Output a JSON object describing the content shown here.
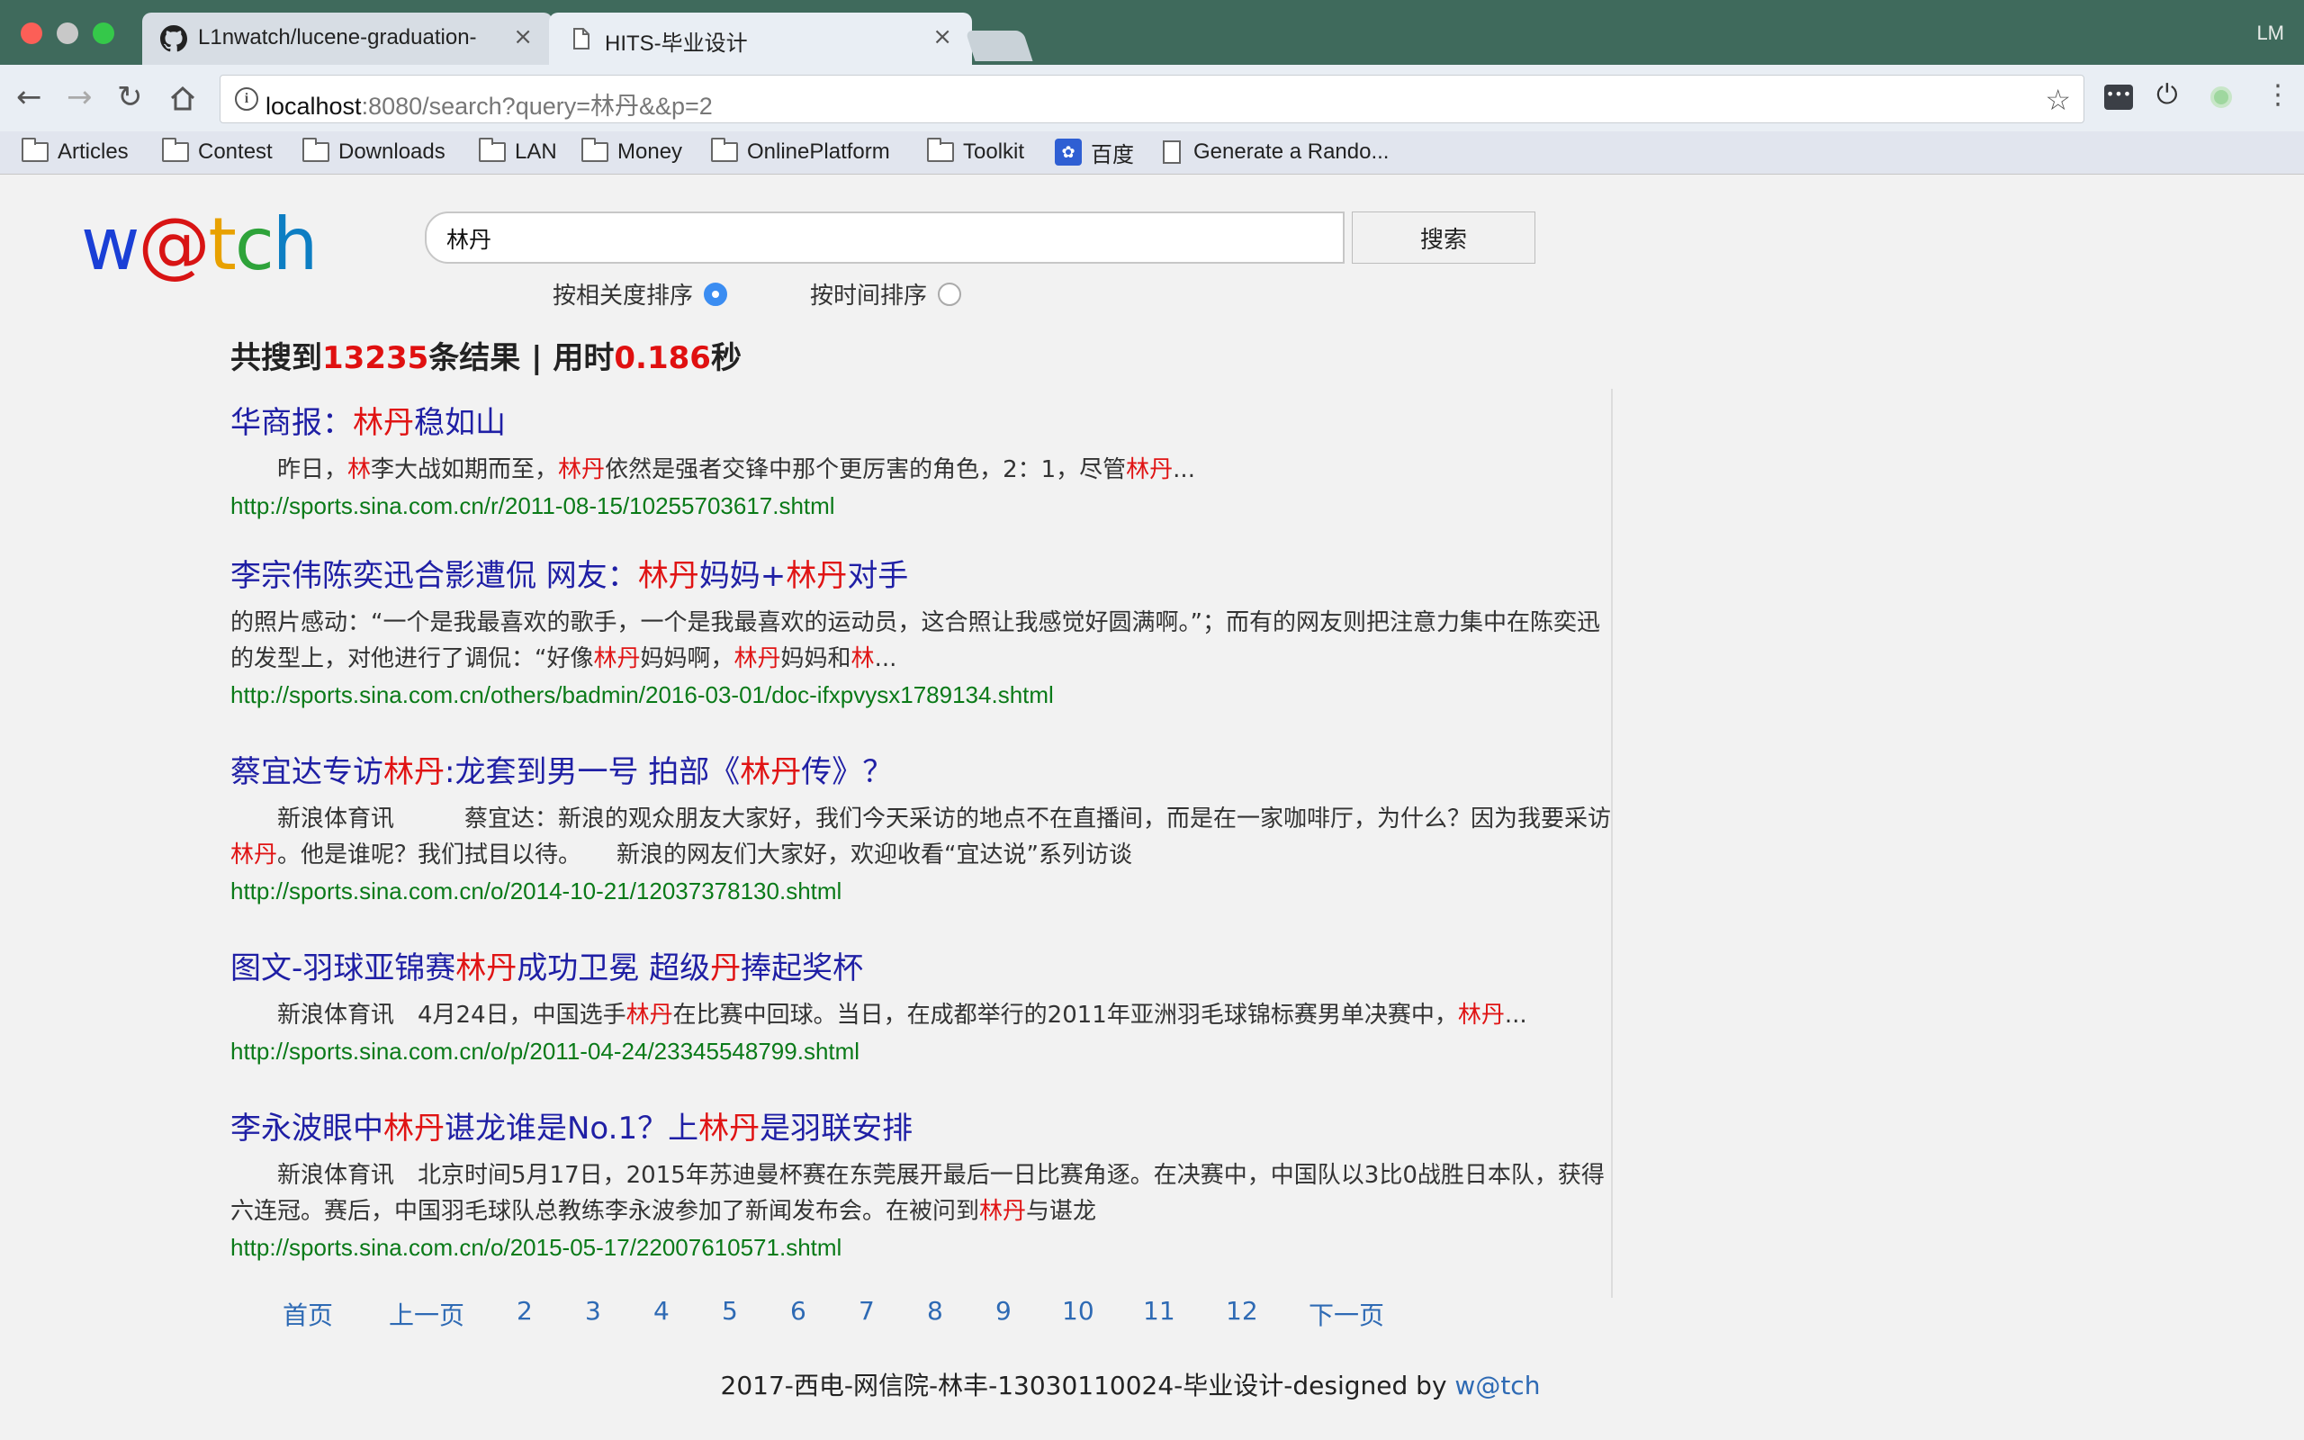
{
  "browser": {
    "profile": "LM",
    "tabs": [
      {
        "title": "L1nwatch/lucene-graduation-",
        "active": false
      },
      {
        "title": "HITS-毕业设计",
        "active": true
      }
    ],
    "url_host": "localhost",
    "url_rest": ":8080/search?query=林丹&&p=2",
    "bookmarks": [
      {
        "label": "Articles",
        "icon": "folder-icon"
      },
      {
        "label": "Contest",
        "icon": "folder-icon"
      },
      {
        "label": "Downloads",
        "icon": "folder-icon"
      },
      {
        "label": "LAN",
        "icon": "folder-icon"
      },
      {
        "label": "Money",
        "icon": "folder-icon"
      },
      {
        "label": "OnlinePlatform",
        "icon": "folder-icon"
      },
      {
        "label": "Toolkit",
        "icon": "folder-icon"
      },
      {
        "label": "百度",
        "icon": "baidu-paw-icon"
      },
      {
        "label": "Generate a Rando...",
        "icon": "page-icon"
      }
    ]
  },
  "logo": {
    "w": "w",
    "at": "@",
    "t": "t",
    "c": "c",
    "h": "h"
  },
  "search": {
    "query": "林丹",
    "button_label": "搜索",
    "sort_relevance": "按相关度排序",
    "sort_time": "按时间排序",
    "selected_sort": "relevance"
  },
  "summary": {
    "prefix": "共搜到",
    "count": "13235",
    "middle": "条结果 | 用时",
    "time": "0.186",
    "suffix": "秒"
  },
  "results": [
    {
      "title": [
        [
          "华商报：",
          false
        ],
        [
          "林丹",
          true
        ],
        [
          "稳如山",
          false
        ]
      ],
      "snippet": [
        [
          "　　昨日，",
          false
        ],
        [
          "林",
          true
        ],
        [
          "李大战如期而至，",
          false
        ],
        [
          "林丹",
          true
        ],
        [
          "依然是强者交锋中那个更厉害的角色，2：1，尽管",
          false
        ],
        [
          "林丹",
          true
        ],
        [
          "...",
          false
        ]
      ],
      "url": "http://sports.sina.com.cn/r/2011-08-15/10255703617.shtml"
    },
    {
      "title": [
        [
          "李宗伟陈奕迅合影遭侃 网友：",
          false
        ],
        [
          "林丹",
          true
        ],
        [
          "妈妈+",
          false
        ],
        [
          "林丹",
          true
        ],
        [
          "对手",
          false
        ]
      ],
      "snippet": [
        [
          "的照片感动：“一个是我最喜欢的歌手，一个是我最喜欢的运动员，这合照让我感觉好圆满啊。”；而有的网友则把注意力集中在陈奕迅的发型上，对他进行了调侃：“好像",
          false
        ],
        [
          "林丹",
          true
        ],
        [
          "妈妈啊，",
          false
        ],
        [
          "林丹",
          true
        ],
        [
          "妈妈和",
          false
        ],
        [
          "林",
          true
        ],
        [
          "...",
          false
        ]
      ],
      "url": "http://sports.sina.com.cn/others/badmin/2016-03-01/doc-ifxpvysx1789134.shtml"
    },
    {
      "title": [
        [
          "蔡宜达专访",
          false
        ],
        [
          "林丹",
          true
        ],
        [
          ":龙套到男一号 拍部《",
          false
        ],
        [
          "林丹",
          true
        ],
        [
          "传》？",
          false
        ]
      ],
      "snippet": [
        [
          "　　新浪体育讯　　　蔡宜达：新浪的观众朋友大家好，我们今天采访的地点不在直播间，而是在一家咖啡厅，为什么？因为我要采访",
          false
        ],
        [
          "林丹",
          true
        ],
        [
          "。他是谁呢？我们拭目以待。　　新浪的网友们大家好，欢迎收看“宜达说”系列访谈",
          false
        ]
      ],
      "url": "http://sports.sina.com.cn/o/2014-10-21/12037378130.shtml"
    },
    {
      "title": [
        [
          "图文-羽球亚锦赛",
          false
        ],
        [
          "林丹",
          true
        ],
        [
          "成功卫冕 超级",
          false
        ],
        [
          "丹",
          true
        ],
        [
          "捧起奖杯",
          false
        ]
      ],
      "snippet": [
        [
          "　　新浪体育讯　4月24日，中国选手",
          false
        ],
        [
          "林丹",
          true
        ],
        [
          "在比赛中回球。当日，在成都举行的2011年亚洲羽毛球锦标赛男单决赛中，",
          false
        ],
        [
          "林丹",
          true
        ],
        [
          "...",
          false
        ]
      ],
      "url": "http://sports.sina.com.cn/o/p/2011-04-24/23345548799.shtml"
    },
    {
      "title": [
        [
          "李永波眼中",
          false
        ],
        [
          "林丹",
          true
        ],
        [
          "谌龙谁是No.1？上",
          false
        ],
        [
          "林丹",
          true
        ],
        [
          "是羽联安排",
          false
        ]
      ],
      "snippet": [
        [
          "　　新浪体育讯　北京时间5月17日，2015年苏迪曼杯赛在东莞展开最后一日比赛角逐。在决赛中，中国队以3比0战胜日本队，获得六连冠。赛后，中国羽毛球队总教练李永波参加了新闻发布会。在被问到",
          false
        ],
        [
          "林丹",
          true
        ],
        [
          "与谌龙",
          false
        ]
      ],
      "url": "http://sports.sina.com.cn/o/2015-05-17/22007610571.shtml"
    }
  ],
  "pager": [
    "首页",
    "上一页",
    "2",
    "3",
    "4",
    "5",
    "6",
    "7",
    "8",
    "9",
    "10",
    "11",
    "12",
    "下一页"
  ],
  "footer": {
    "text": "2017-西电-网信院-林丰-13030110024-毕业设计-designed by ",
    "link": "w@tch"
  }
}
